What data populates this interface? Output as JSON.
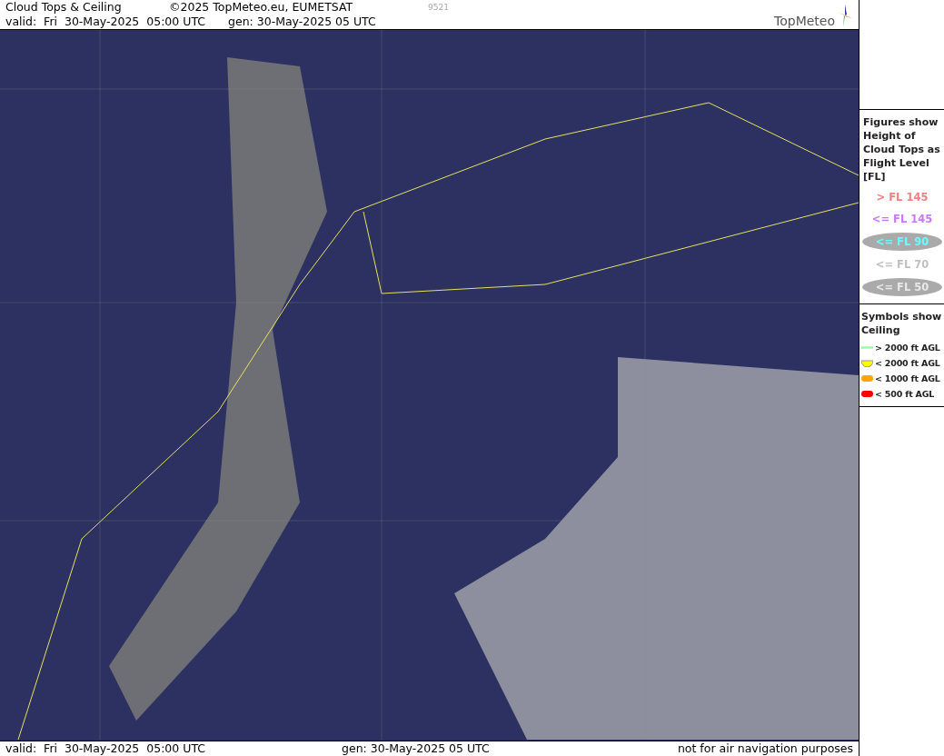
{
  "header": {
    "title": "Cloud Tops & Ceiling",
    "copyright": "©2025 TopMeteo.eu, EUMETSAT",
    "code": "9521",
    "valid": "valid:  Fri  30-May-2025  05:00 UTC",
    "generated": "gen: 30-May-2025 05 UTC",
    "logo": "TopMeteo"
  },
  "figures_legend": {
    "heading": "Figures show Height of Cloud Tops as Flight Level  [FL]",
    "items": [
      {
        "label": "> FL 145",
        "color": "#f08080",
        "kind": "plain"
      },
      {
        "label": "<= FL 145",
        "color": "#cc77ff",
        "kind": "plain"
      },
      {
        "label": "<= FL 90",
        "color": "#66ffff",
        "kind": "oval"
      },
      {
        "label": "<= FL 70",
        "color": "#c0c0c0",
        "kind": "plain"
      },
      {
        "label": "<= FL 50",
        "color": "#e8e8e8",
        "kind": "oval"
      }
    ]
  },
  "symbols_legend": {
    "heading": "Symbols show Ceiling",
    "items": [
      {
        "label": "> 2000 ft AGL",
        "color": "#99ffaa",
        "kind": "line"
      },
      {
        "label": "< 2000 ft AGL",
        "color": "#ffff00",
        "kind": "bowl"
      },
      {
        "label": "< 1000 ft AGL",
        "color": "#ffa500",
        "kind": "pill"
      },
      {
        "label": "< 500 ft AGL",
        "color": "#ff0000",
        "kind": "pill"
      }
    ]
  },
  "footer": {
    "valid": "valid:  Fri  30-May-2025  05:00 UTC",
    "generated": "gen: 30-May-2025 05 UTC",
    "notice": "not for air navigation purposes"
  }
}
